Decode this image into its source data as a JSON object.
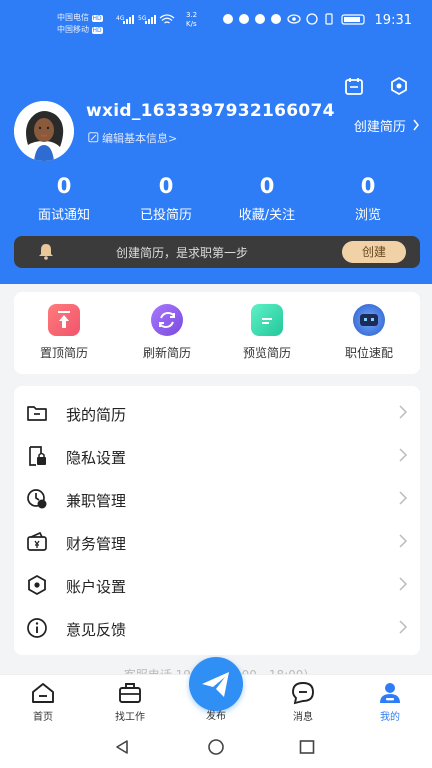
{
  "status_bar": {
    "carrier1": "中国电信",
    "carrier2": "中国移动",
    "hd_badge": "HD",
    "net_speed_value": "3.2",
    "net_speed_unit": "K/s",
    "signal_labels": [
      "4G",
      "5G"
    ],
    "time": "19:31"
  },
  "profile": {
    "username": "wxid_1633397932166074",
    "edit_info": "编辑基本信息>",
    "create_resume": "创建简历"
  },
  "stats": [
    {
      "value": "0",
      "label": "面试通知"
    },
    {
      "value": "0",
      "label": "已投简历"
    },
    {
      "value": "0",
      "label": "收藏/关注"
    },
    {
      "value": "0",
      "label": "浏览"
    }
  ],
  "banner": {
    "text": "创建简历，是求职第一步",
    "button": "创建"
  },
  "quick_actions": [
    {
      "label": "置顶简历",
      "icon": "pin-top-icon",
      "color": "#f0556c"
    },
    {
      "label": "刷新简历",
      "icon": "refresh-icon",
      "color": "#8a58e8"
    },
    {
      "label": "预览简历",
      "icon": "preview-icon",
      "color": "#2fd4a6"
    },
    {
      "label": "职位速配",
      "icon": "robot-icon",
      "color": "#3a6fd8"
    }
  ],
  "menu": [
    {
      "label": "我的简历",
      "icon": "folder-icon"
    },
    {
      "label": "隐私设置",
      "icon": "privacy-lock-icon"
    },
    {
      "label": "兼职管理",
      "icon": "clock-coin-icon"
    },
    {
      "label": "财务管理",
      "icon": "wallet-icon"
    },
    {
      "label": "账户设置",
      "icon": "hexagon-settings-icon"
    },
    {
      "label": "意见反馈",
      "icon": "info-icon"
    }
  ],
  "service_text": "客服电话 1993...3(9:00 - 18:00)",
  "tabs": [
    {
      "label": "首页",
      "icon": "home-icon"
    },
    {
      "label": "找工作",
      "icon": "briefcase-icon"
    },
    {
      "label": "发布",
      "icon": "send-icon"
    },
    {
      "label": "消息",
      "icon": "message-icon"
    },
    {
      "label": "我的",
      "icon": "person-icon"
    }
  ],
  "colors": {
    "brand_blue": "#2f7df6",
    "banner_dark": "#3b3b3b",
    "banner_button": "#f1d2a6",
    "publish_blue": "#2f8ff5"
  }
}
